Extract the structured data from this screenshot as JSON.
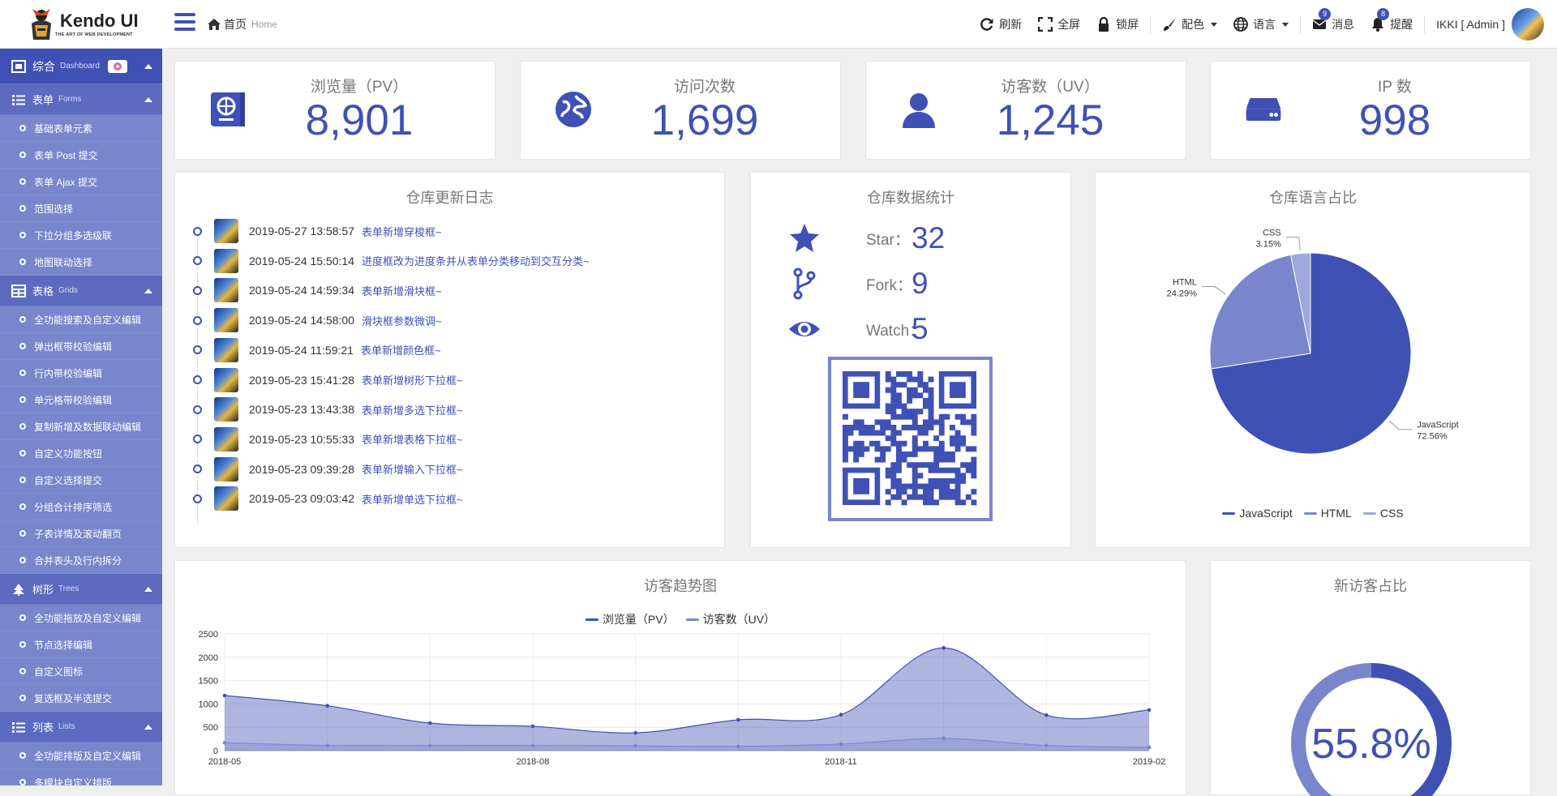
{
  "brand": {
    "name": "Kendo UI",
    "tagline": "THE ART OF WEB DEVELOPMENT"
  },
  "breadcrumb": {
    "home": "首页",
    "home_en": "Home"
  },
  "toolbar": {
    "refresh": "刷新",
    "fullscreen": "全屏",
    "lock": "锁屏",
    "theme": "配色",
    "language": "语言",
    "messages": "消息",
    "messages_badge": "9",
    "reminders": "提醒",
    "reminders_badge": "8",
    "user": "IKKI [ Admin ]"
  },
  "sidebar": {
    "dashboard": {
      "label": "综合",
      "en": "Dashboard"
    },
    "groups": [
      {
        "label": "表单",
        "en": "Forms",
        "icon": "list-icon",
        "items": [
          "基础表单元素",
          "表单 Post 提交",
          "表单 Ajax 提交",
          "范围选择",
          "下拉分组多选级联",
          "地图联动选择"
        ]
      },
      {
        "label": "表格",
        "en": "Grids",
        "icon": "table-icon",
        "items": [
          "全功能搜索及自定义编辑",
          "弹出框带校验编辑",
          "行内带校验编辑",
          "单元格带校验编辑",
          "复制新增及数据联动编辑",
          "自定义功能按钮",
          "自定义选择提交",
          "分组合计排序筛选",
          "子表详情及滚动翻页",
          "合并表头及行内拆分"
        ]
      },
      {
        "label": "树形",
        "en": "Trees",
        "icon": "tree-icon",
        "items": [
          "全功能拖放及自定义编辑",
          "节点选择编辑",
          "自定义图标",
          "复选框及半选提交"
        ]
      },
      {
        "label": "列表",
        "en": "Lists",
        "icon": "list-icon",
        "items": [
          "全功能排版及自定义编辑",
          "多模块自定义排版"
        ]
      }
    ]
  },
  "stats": [
    {
      "label": "浏览量（PV）",
      "value": "8,901",
      "icon": "passport-icon"
    },
    {
      "label": "访问次数",
      "value": "1,699",
      "icon": "globe-icon"
    },
    {
      "label": "访客数（UV）",
      "value": "1,245",
      "icon": "user-icon"
    },
    {
      "label": "IP 数",
      "value": "998",
      "icon": "server-icon"
    }
  ],
  "changelog": {
    "title": "仓库更新日志",
    "entries": [
      {
        "time": "2019-05-27 13:58:57",
        "msg": "表单新增穿梭框~"
      },
      {
        "time": "2019-05-24 15:50:14",
        "msg": "进度框改为进度条并从表单分类移动到交互分类~"
      },
      {
        "time": "2019-05-24 14:59:34",
        "msg": "表单新增滑块框~"
      },
      {
        "time": "2019-05-24 14:58:00",
        "msg": "滑块框参数微调~"
      },
      {
        "time": "2019-05-24 11:59:21",
        "msg": "表单新增颜色框~"
      },
      {
        "time": "2019-05-23 15:41:28",
        "msg": "表单新增树形下拉框~"
      },
      {
        "time": "2019-05-23 13:43:38",
        "msg": "表单新增多选下拉框~"
      },
      {
        "time": "2019-05-23 10:55:33",
        "msg": "表单新增表格下拉框~"
      },
      {
        "time": "2019-05-23 09:39:28",
        "msg": "表单新增输入下拉框~"
      },
      {
        "time": "2019-05-23 09:03:42",
        "msg": "表单新增单选下拉框~"
      }
    ]
  },
  "repo": {
    "title": "仓库数据统计",
    "star_label": "Star：",
    "star": "32",
    "fork_label": "Fork：",
    "fork": "9",
    "watch_label": "Watch：",
    "watch": "5"
  },
  "colors": {
    "primary": "#3f51b5",
    "secondary": "#7986cb",
    "tertiary": "#9fa8da",
    "sidebar": "#7986cb"
  },
  "chart_data": [
    {
      "type": "pie",
      "title": "仓库语言占比",
      "categories": [
        "JavaScript",
        "HTML",
        "CSS"
      ],
      "values": [
        72.56,
        24.29,
        3.15
      ],
      "labels": [
        "72.56%",
        "24.29%",
        "3.15%"
      ],
      "legend": "bottom"
    },
    {
      "type": "area",
      "title": "访客趋势图",
      "x": [
        "2018-05",
        "2018-06",
        "2018-07",
        "2018-08",
        "2018-09",
        "2018-10",
        "2018-11",
        "2018-12",
        "2019-01",
        "2019-02"
      ],
      "x_ticks": [
        "2018-05",
        "2018-08",
        "2018-11",
        "2019-02"
      ],
      "series": [
        {
          "name": "浏览量（PV）",
          "values": [
            1180,
            960,
            590,
            520,
            380,
            660,
            770,
            2200,
            760,
            870
          ]
        },
        {
          "name": "访客数（UV）",
          "values": [
            170,
            110,
            110,
            110,
            100,
            90,
            140,
            260,
            110,
            70
          ]
        }
      ],
      "ylim": [
        0,
        2500
      ],
      "yticks": [
        0,
        500,
        1000,
        1500,
        2000,
        2500
      ],
      "grid": true,
      "legend": "top"
    },
    {
      "type": "pie",
      "title": "新访客占比",
      "values": [
        55.8,
        44.2
      ],
      "label": "55.8%"
    }
  ]
}
